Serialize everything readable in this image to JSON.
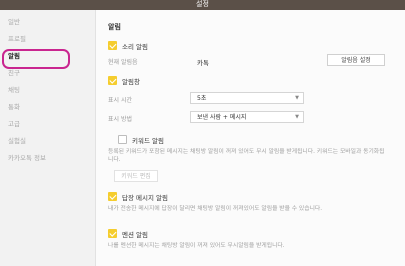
{
  "window": {
    "title": "설정"
  },
  "sidebar": {
    "items": [
      {
        "label": "일반"
      },
      {
        "label": "프로필"
      },
      {
        "label": "알림"
      },
      {
        "label": "친구"
      },
      {
        "label": "채팅"
      },
      {
        "label": "통화"
      },
      {
        "label": "고급"
      },
      {
        "label": "실험실"
      },
      {
        "label": "카카오톡 정보"
      }
    ],
    "active_index": 2
  },
  "notifications": {
    "section_title": "알림",
    "sound": {
      "checkbox_label": "소리 알림",
      "checked": true,
      "current_label": "현재 알림음",
      "current_value": "카톡",
      "button_label": "알림음 설정"
    },
    "popup": {
      "checkbox_label": "알림창",
      "checked": true,
      "time_label": "표시 시간",
      "time_value": "5초",
      "method_label": "표시 방법",
      "method_value": "보낸 사람 + 메시지"
    },
    "keyword": {
      "checkbox_label": "키워드 알림",
      "checked": false,
      "description": "등록된 키워드가 포함된 메시지는 채팅방 알림이 꺼져 있어도 무시 알림을 받게됩니다. 키워드는 모바일과 동기화됩니다.",
      "button_label": "키워드 편집"
    },
    "reply": {
      "checkbox_label": "답장 메시지 알림",
      "checked": true,
      "description": "내가 전송한 메시지에 답장이 달리면 채팅방 알림이 꺼져있어도 알림을 받을 수 있습니다."
    },
    "mention": {
      "checkbox_label": "멘션 알림",
      "checked": true,
      "description": "나를 멘션한 메시지는 채팅방 알림이 꺼져 있어도 무시알림을 받게됩니다."
    }
  },
  "colors": {
    "accent_yellow": "#f5cd2e",
    "highlight_ring": "#c9258f",
    "titlebar": "#5b5048"
  }
}
